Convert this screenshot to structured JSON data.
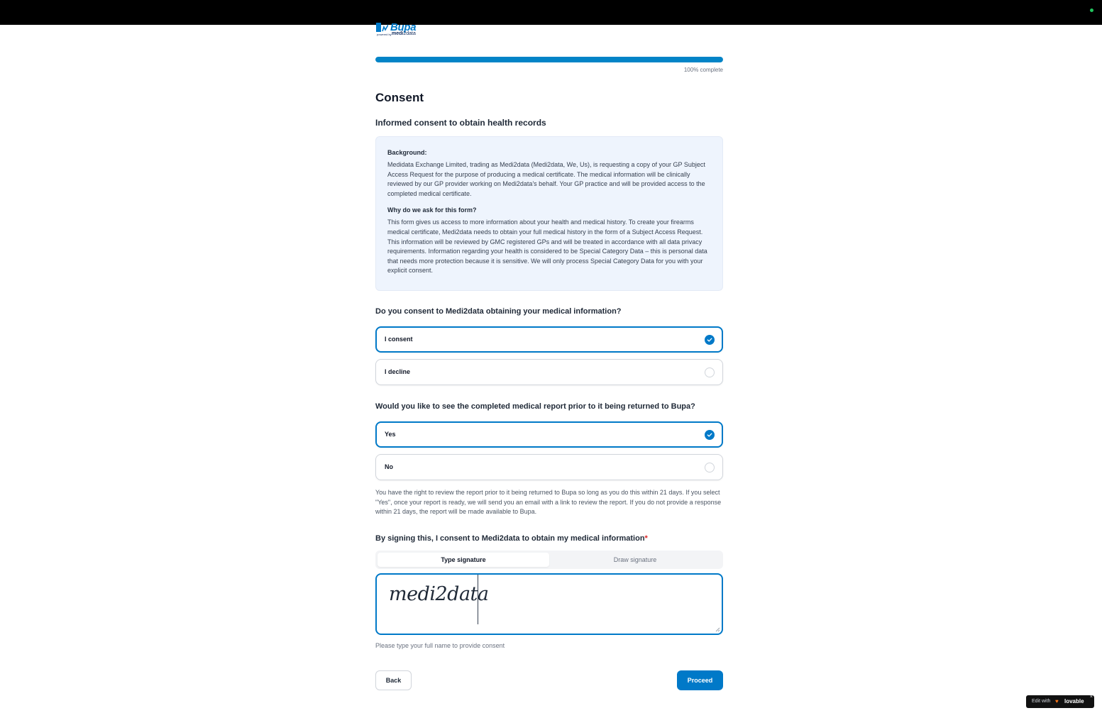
{
  "brand": {
    "name": "Bupa",
    "powered_by": "powered by",
    "partner_prefix": "medi",
    "partner_suffix": "2data"
  },
  "progress": {
    "percent": 100,
    "label": "100% complete"
  },
  "page_title": "Consent",
  "subtitle": "Informed consent to obtain health records",
  "info": {
    "background_heading": "Background:",
    "background_text": "Medidata Exchange Limited, trading as Medi2data (Medi2data, We, Us), is requesting a copy of your GP Subject Access Request for the purpose of producing a medical certificate. The medical information will be clinically reviewed by our GP provider working on Medi2data's behalf. Your GP practice and will be provided access to the completed medical certificate.",
    "why_heading": "Why do we ask for this form?",
    "why_text": "This form gives us access to more information about your health and medical history. To create your firearms medical certificate, Medi2data needs to obtain your full medical history in the form of a Subject Access Request. This information will be reviewed by GMC registered GPs and will be treated in accordance with all data privacy requirements. Information regarding your health is considered to be Special Category Data – this is personal data that needs more protection because it is sensitive. We will only process Special Category Data for you with your explicit consent."
  },
  "consent_question": {
    "text": "Do you consent to Medi2data obtaining your medical information?",
    "options": [
      {
        "label": "I consent",
        "selected": true
      },
      {
        "label": "I decline",
        "selected": false
      }
    ]
  },
  "review_question": {
    "text": "Would you like to see the completed medical report prior to it being returned to Bupa?",
    "options": [
      {
        "label": "Yes",
        "selected": true
      },
      {
        "label": "No",
        "selected": false
      }
    ]
  },
  "review_note": "You have the right to review the report prior to it being returned to Bupa so long as you do this within 21 days. If you select \"Yes\", once your report is ready, we will send you an email with a link to review the report. If you do not provide a response within 21 days, the report will be made available to Bupa.",
  "signature": {
    "question": "By signing this, I consent to Medi2data to obtain my medical information",
    "required_mark": "*",
    "tabs": [
      "Type signature",
      "Draw signature"
    ],
    "active_tab": 0,
    "value": "medi2data",
    "hint": "Please type your full name to provide consent"
  },
  "buttons": {
    "back": "Back",
    "proceed": "Proceed"
  },
  "badge": {
    "prefix": "Edit with",
    "brand": "lovable",
    "close": "×"
  },
  "colors": {
    "accent": "#0079c8",
    "progress": "#0284c7",
    "info_bg": "#eef4fd",
    "required": "#dc2626"
  },
  "icons": {
    "check": "check-icon",
    "brand_mark": "bupa-logo-icon",
    "heart": "heart-icon"
  }
}
